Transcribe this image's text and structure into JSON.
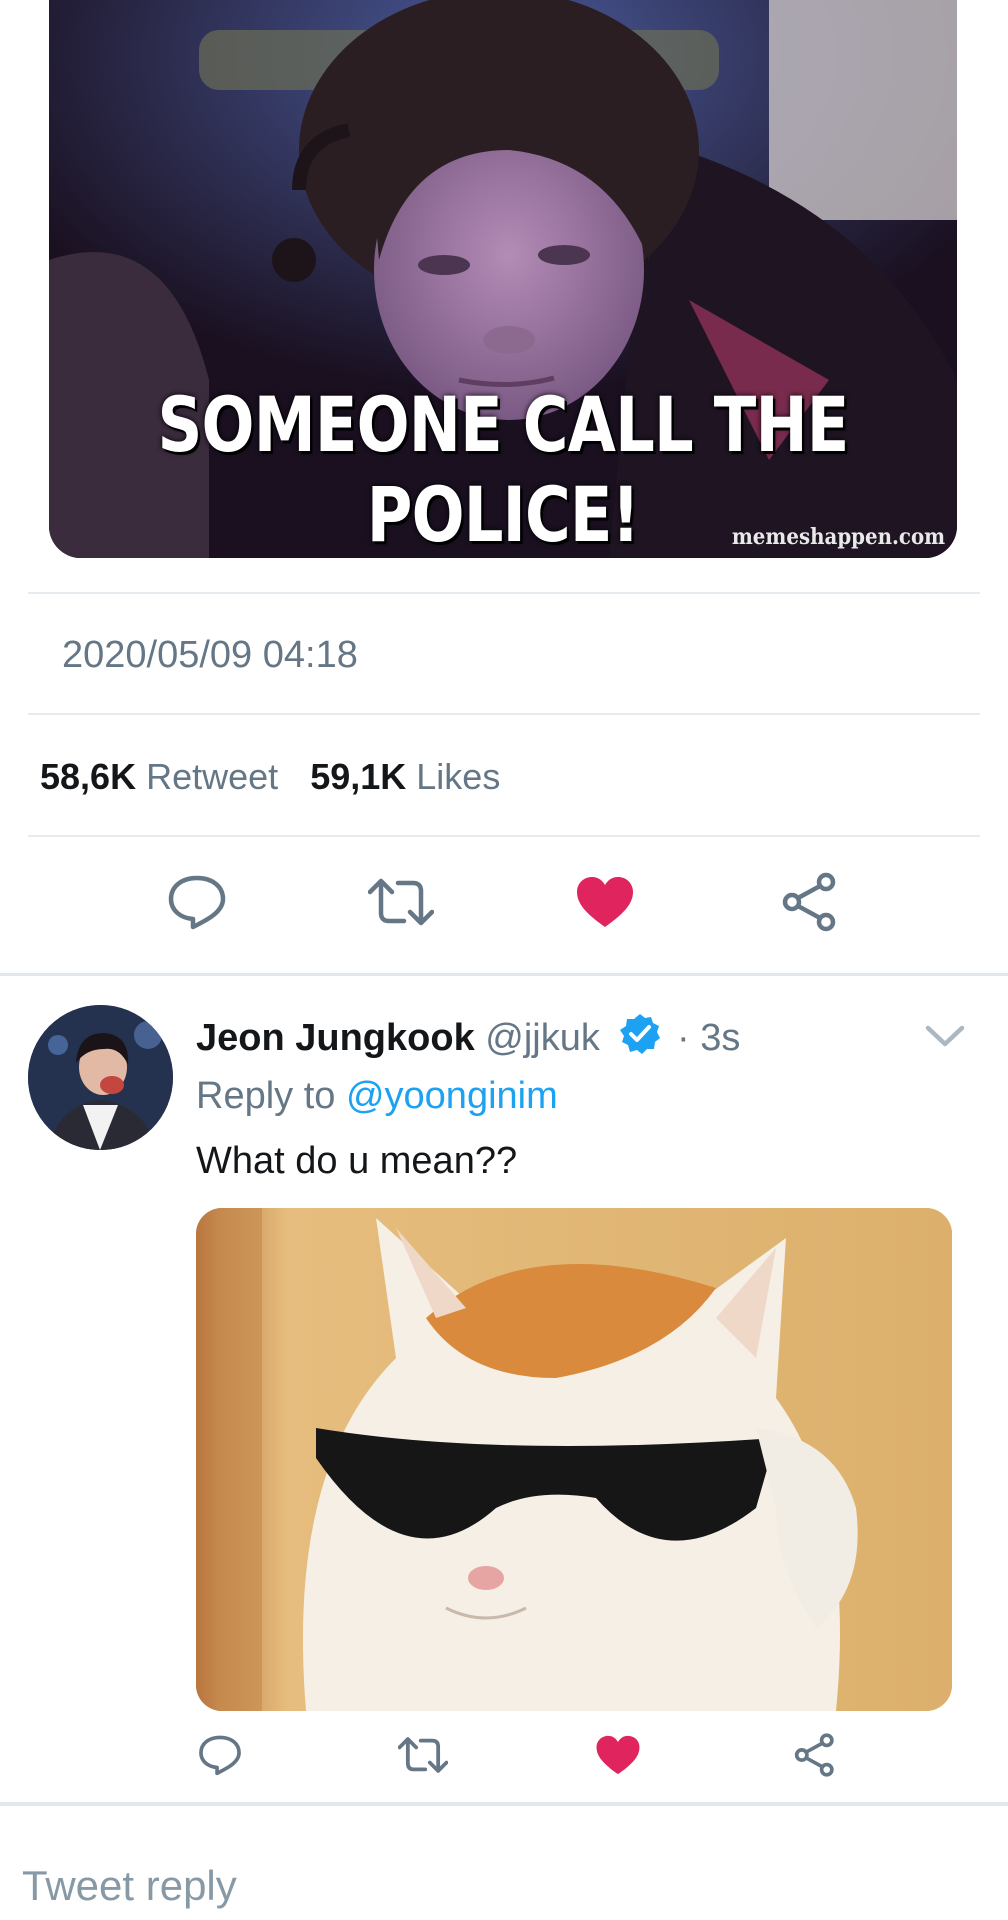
{
  "focused_tweet": {
    "media": {
      "caption_line1": "SOMEONE CALL THE",
      "caption_line2": "POLICE!",
      "watermark": "memeshappen.com"
    },
    "timestamp": "2020/05/09 04:18",
    "stats": {
      "retweets_count": "58,6K",
      "retweets_label": "Retweet",
      "likes_count": "59,1K",
      "likes_label": "Likes"
    },
    "actions": [
      "reply-icon",
      "retweet-icon",
      "like-icon-filled",
      "share-icon"
    ]
  },
  "reply_tweet": {
    "author_name": "Jeon Jungkook",
    "author_handle": "@jjkuk",
    "time": "· 3s",
    "reply_to_prefix": "Reply to",
    "reply_to_handle": "@yoonginim",
    "text": "What do u mean??",
    "actions": [
      "reply-icon",
      "retweet-icon",
      "like-icon-filled",
      "share-icon"
    ]
  },
  "composer": {
    "placeholder": "Tweet reply"
  },
  "colors": {
    "like": "#e0245e",
    "link": "#1da1f2",
    "muted": "#657786",
    "icon": "#657786",
    "divider": "#e6ecf0"
  }
}
